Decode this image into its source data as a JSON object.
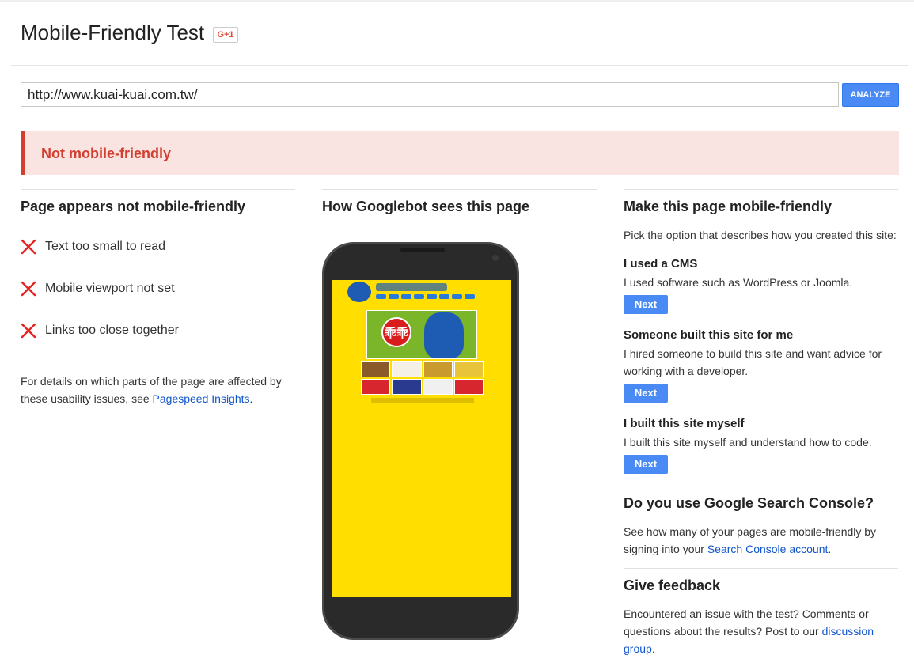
{
  "header": {
    "title": "Mobile-Friendly Test",
    "gplus_label": "G+1"
  },
  "search": {
    "url_value": "http://www.kuai-kuai.com.tw/",
    "analyze_label": "ANALYZE"
  },
  "result": {
    "status": "Not mobile-friendly",
    "status_color": "#d23f31"
  },
  "issues": {
    "heading": "Page appears not mobile-friendly",
    "items": [
      {
        "label": "Text too small to read",
        "icon": "cross-icon"
      },
      {
        "label": "Mobile viewport not set",
        "icon": "cross-icon"
      },
      {
        "label": "Links too close together",
        "icon": "cross-icon"
      }
    ],
    "details_prefix": "For details on which parts of the page are affected by these usability issues, see ",
    "details_link": "Pagespeed Insights",
    "details_suffix": "."
  },
  "preview": {
    "heading": "How Googlebot sees this page",
    "hero_logo_text": "乖乖"
  },
  "make_friendly": {
    "heading": "Make this page mobile-friendly",
    "intro": "Pick the option that describes how you created this site:",
    "options": [
      {
        "title": "I used a CMS",
        "desc": "I used software such as WordPress or Joomla.",
        "button": "Next"
      },
      {
        "title": "Someone built this site for me",
        "desc": "I hired someone to build this site and want advice for working with a developer.",
        "button": "Next"
      },
      {
        "title": "I built this site myself",
        "desc": "I built this site myself and understand how to code.",
        "button": "Next"
      }
    ]
  },
  "search_console": {
    "heading": "Do you use Google Search Console?",
    "text_prefix": "See how many of your pages are mobile-friendly by signing into your ",
    "link": "Search Console account",
    "text_suffix": "."
  },
  "feedback": {
    "heading": "Give feedback",
    "text_prefix": "Encountered an issue with the test? Comments or questions about the results? Post to our ",
    "link": "discussion group",
    "text_suffix": "."
  },
  "colors": {
    "accent_blue": "#4a8af4",
    "link_blue": "#1155cc",
    "banner_bg": "#f9e4e1",
    "site_yellow": "#ffde00"
  }
}
